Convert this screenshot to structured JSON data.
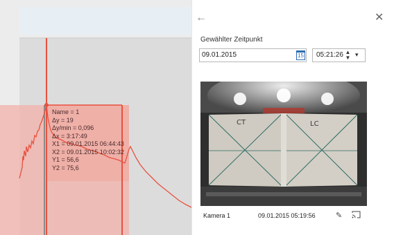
{
  "tooltip": {
    "name": "Name = 1",
    "dy": "Δy = 19",
    "dy_min": "Δy/min = 0,096",
    "dx": "Δx = 3:17:49",
    "x1": "X1 = 09.01.2015 06:44:43",
    "x2": "X2 = 09.01.2015 10:02:32",
    "y1": "Y1 = 56,6",
    "y2": "Y2 = 75,6"
  },
  "panel": {
    "back_icon": "arrow-left-icon",
    "close_icon": "close-icon",
    "zeitpunkt_label": "Gewählter Zeitpunkt",
    "date_value": "09.01.2015",
    "calendar_icon_text": "15",
    "time_value": "05:21:26",
    "camera": {
      "marking_left": "CT",
      "marking_right": "LC",
      "label": "Kamera 1",
      "timestamp": "09.01.2015 05:19:56"
    }
  },
  "colors": {
    "series": "#e8513f",
    "selection": "#f3b1ab",
    "accent": "#2b6cb0"
  }
}
